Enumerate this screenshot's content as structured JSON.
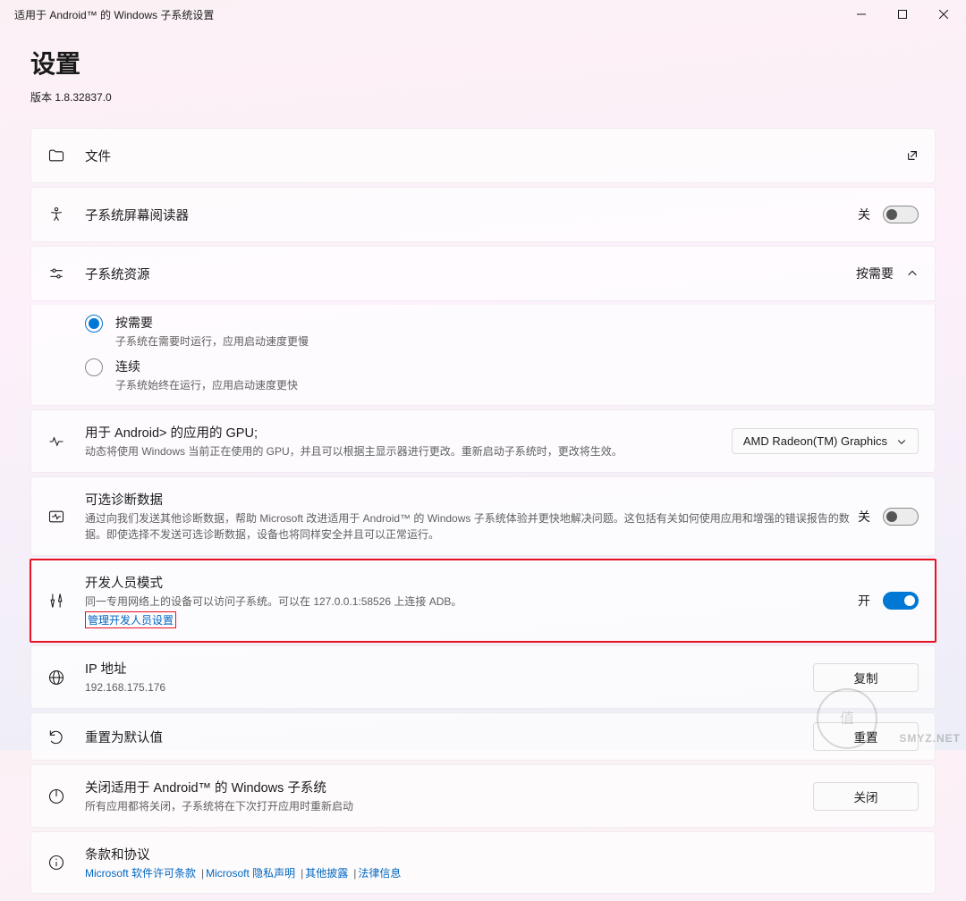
{
  "window": {
    "app_title": "适用于 Android™ 的 Windows 子系统设置"
  },
  "header": {
    "title": "设置",
    "version_label": "版本 1.8.32837.0"
  },
  "cards": {
    "files": {
      "title": "文件"
    },
    "screen_reader": {
      "title": "子系统屏幕阅读器",
      "state": "关"
    },
    "resources": {
      "title": "子系统资源",
      "state": "按需要",
      "options": {
        "on_demand": {
          "label": "按需要",
          "desc": "子系统在需要时运行，应用启动速度更慢"
        },
        "continuous": {
          "label": "连续",
          "desc": "子系统始终在运行，应用启动速度更快"
        }
      }
    },
    "gpu": {
      "title": "用于 Android> 的应用的 GPU;",
      "desc": "动态将使用 Windows 当前正在使用的 GPU，并且可以根据主显示器进行更改。重新启动子系统时，更改将生效。",
      "selected": "AMD Radeon(TM) Graphics"
    },
    "diagnostics": {
      "title": "可选诊断数据",
      "desc": "通过向我们发送其他诊断数据，帮助 Microsoft 改进适用于 Android™ 的 Windows 子系统体验并更快地解决问题。这包括有关如何使用应用和增强的错误报告的数据。即使选择不发送可选诊断数据，设备也将同样安全并且可以正常运行。",
      "state": "关"
    },
    "dev_mode": {
      "title": "开发人员模式",
      "desc": "同一专用网络上的设备可以访问子系统。可以在 127.0.0.1:58526 上连接 ADB。",
      "link": "管理开发人员设置",
      "state": "开"
    },
    "ip": {
      "title": "IP 地址",
      "value": "192.168.175.176",
      "action": "复制"
    },
    "reset": {
      "title": "重置为默认值",
      "action": "重置"
    },
    "shutdown": {
      "title": "关闭适用于 Android™ 的 Windows 子系统",
      "desc": "所有应用都将关闭，子系统将在下次打开应用时重新启动",
      "action": "关闭"
    },
    "terms": {
      "title": "条款和协议",
      "links": {
        "license": "Microsoft 软件许可条款",
        "privacy": "Microsoft 隐私声明",
        "other": "其他披露",
        "legal": "法律信息"
      }
    }
  },
  "watermark": "SMYZ.NET"
}
